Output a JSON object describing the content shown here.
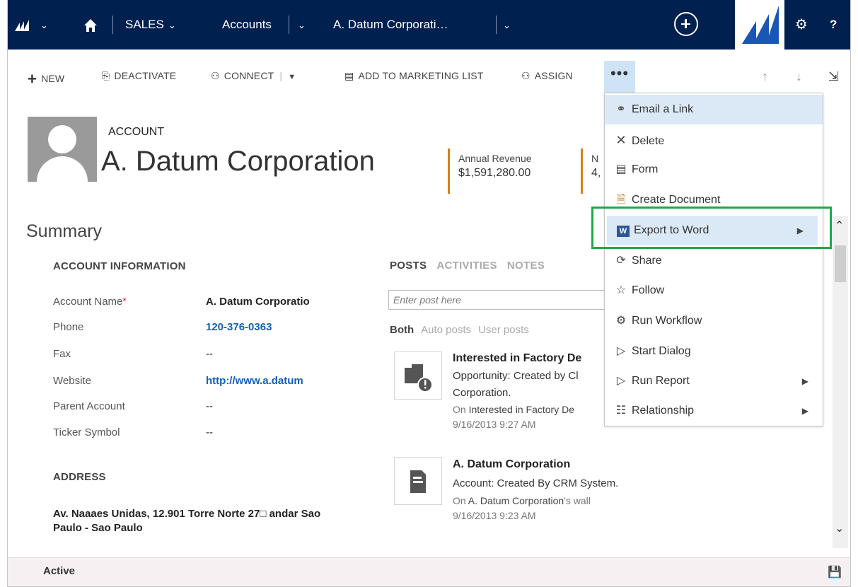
{
  "nav": {
    "sales": "SALES",
    "accounts": "Accounts",
    "record": "A. Datum Corporati…",
    "help": "?"
  },
  "commands": {
    "new": "NEW",
    "deactivate": "DEACTIVATE",
    "connect": "CONNECT",
    "add_to_marketing_list": "ADD TO MARKETING LIST",
    "assign": "ASSIGN",
    "more": "•••"
  },
  "header": {
    "entity_type": "ACCOUNT",
    "entity_name": "A. Datum Corporation",
    "annual_revenue_label": "Annual Revenue",
    "annual_revenue_value": "$1,591,280.00",
    "field2_label": "N",
    "field2_value": "4,"
  },
  "summary": {
    "title": "Summary",
    "account_info_heading": "ACCOUNT INFORMATION",
    "fields": [
      {
        "label": "Account Name",
        "value": "A. Datum Corporatio"
      },
      {
        "label": "Phone",
        "value": "120-376-0363"
      },
      {
        "label": "Fax",
        "value": "--"
      },
      {
        "label": "Website",
        "value": "http://www.a.datum"
      },
      {
        "label": "Parent Account",
        "value": "--"
      },
      {
        "label": "Ticker Symbol",
        "value": "--"
      }
    ],
    "address_heading": "ADDRESS",
    "address_text": "Av. Naaaes Unidas, 12.901 Torre Norte 27□ andar Sao Paulo - Sao Paulo"
  },
  "posts": {
    "tabs": [
      "POSTS",
      "ACTIVITIES",
      "NOTES"
    ],
    "input_placeholder": "Enter post here",
    "filters": [
      "Both",
      "Auto posts",
      "User posts"
    ],
    "items": [
      {
        "title": "Interested in Factory De",
        "line1": "Opportunity: Created by Cl",
        "line2": "Corporation.",
        "meta_prefix": "On ",
        "meta_link": "Interested in Factory De",
        "time": "9/16/2013 9:27 AM"
      },
      {
        "title": "A. Datum Corporation",
        "line1": "Account: Created By CRM System.",
        "meta_prefix": "On ",
        "meta_link": "A. Datum Corporation",
        "meta_suffix": "'s wall",
        "time": "9/16/2013 9:23 AM"
      }
    ]
  },
  "menu": {
    "items": [
      {
        "label": "Email a Link",
        "icon": "link-icon"
      },
      {
        "label": "Delete",
        "icon": "delete-icon"
      },
      {
        "label": "Form",
        "icon": "form-icon"
      },
      {
        "label": "Create Document",
        "icon": "document-icon"
      },
      {
        "label": "Export to Word",
        "icon": "word-icon"
      },
      {
        "label": "Share",
        "icon": "share-icon"
      },
      {
        "label": "Follow",
        "icon": "star-icon"
      },
      {
        "label": "Run Workflow",
        "icon": "workflow-icon"
      },
      {
        "label": "Start Dialog",
        "icon": "dialog-icon"
      },
      {
        "label": "Run Report",
        "icon": "report-icon"
      },
      {
        "label": "Relationship",
        "icon": "relationship-icon"
      }
    ]
  },
  "status": {
    "state": "Active"
  },
  "colors": {
    "nav_bg": "#002050",
    "accent_orange": "#d97f16",
    "link_blue": "#1160b7",
    "highlight_green": "#1da84a",
    "menu_hover": "#dbe8f6"
  }
}
